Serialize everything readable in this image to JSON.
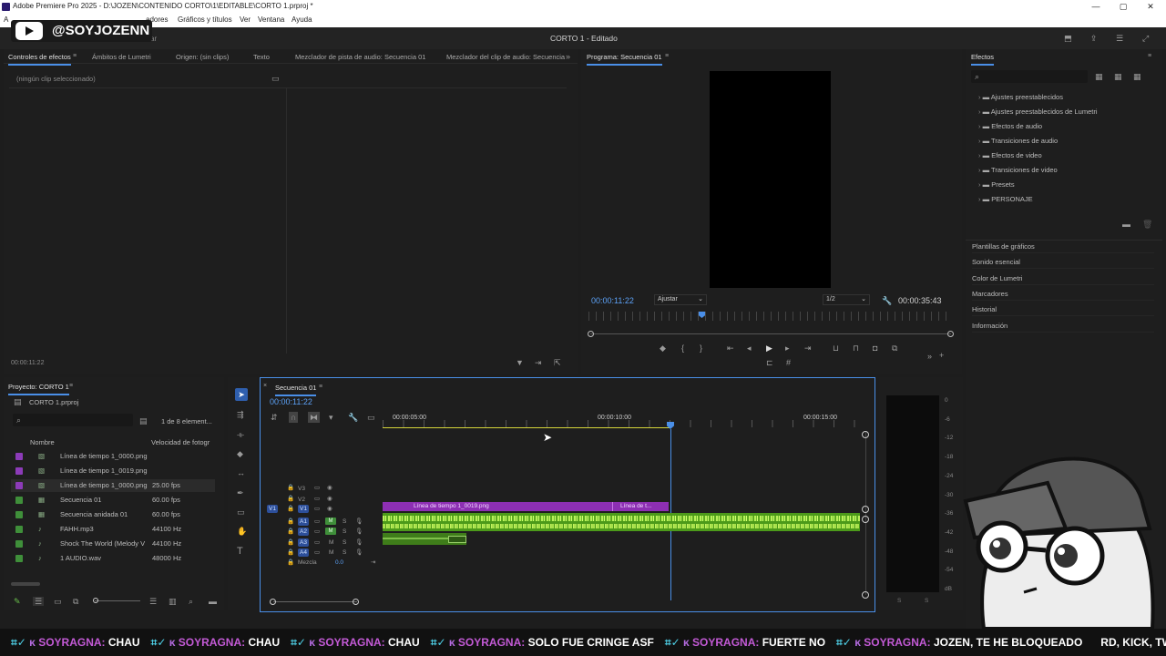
{
  "titlebar": {
    "title": "Adobe Premiere Pro 2025 - D:\\JOZEN\\CONTENIDO CORTO\\1\\EDITABLE\\CORTO 1.prproj *"
  },
  "menu": {
    "items": [
      "A",
      "adores",
      "Gráficos y títulos",
      "Ver",
      "Ventana",
      "Ayuda"
    ],
    "hidden_partial": "ar"
  },
  "workspace": {
    "title": "CORTO 1 - Editado"
  },
  "overlay": {
    "handle": "@SOYJOZENN"
  },
  "left_top_tabs": [
    "Controles de efectos",
    "Ámbitos de Lumetri",
    "Origen: (sin clips)",
    "Texto",
    "Mezclador de pista de audio: Secuencia 01",
    "Mezclador del clip de audio: Secuencia"
  ],
  "effect_controls": {
    "empty": "(ningún clip seleccionado)",
    "timecode": "00:00:11:22"
  },
  "program": {
    "tab": "Programa: Secuencia 01",
    "timecode": "00:00:11:22",
    "fit": "Ajustar",
    "res": "1/2",
    "duration": "00:00:35:43"
  },
  "effects": {
    "tab": "Efectos",
    "tree": [
      "Ajustes preestablecidos",
      "Ajustes preestablecidos de Lumetri",
      "Efectos de audio",
      "Transiciones de audio",
      "Efectos de video",
      "Transiciones de video",
      "Presets",
      "PERSONAJE"
    ],
    "panels": [
      "Plantillas de gráficos",
      "Sonido esencial",
      "Color de Lumetri",
      "Marcadores",
      "Historial",
      "Información"
    ]
  },
  "project": {
    "tab": "Proyecto: CORTO 1",
    "file": "CORTO 1.prproj",
    "count": "1 de 8 element...",
    "col_name": "Nombre",
    "col_fps": "Velocidad de fotogr",
    "items": [
      {
        "name": "Línea de tiempo 1_0000.png",
        "fps": "",
        "color": "#8c3bb8"
      },
      {
        "name": "Línea de tiempo 1_0019.png",
        "fps": "",
        "color": "#8c3bb8"
      },
      {
        "name": "Línea de tiempo 1_0000.png",
        "fps": "25.00 fps",
        "color": "#8c3bb8"
      },
      {
        "name": "Secuencia 01",
        "fps": "60.00 fps",
        "color": "#3f8f3a"
      },
      {
        "name": "Secuencia anidada 01",
        "fps": "60.00 fps",
        "color": "#3f8f3a"
      },
      {
        "name": "FAHH.mp3",
        "fps": "44100 Hz",
        "color": "#3f8f3a"
      },
      {
        "name": "Shock The World (Melody V",
        "fps": "44100 Hz",
        "color": "#3f8f3a"
      },
      {
        "name": "1 AUDIO.wav",
        "fps": "48000 Hz",
        "color": "#3f8f3a"
      }
    ]
  },
  "timeline": {
    "tab": "Secuencia 01",
    "timecode": "00:00:11:22",
    "ruler": [
      "00:00:05:00",
      "00:00:10:00",
      "00:00:15:00"
    ],
    "tracks": [
      "V3",
      "V2",
      "V1",
      "A1",
      "A2",
      "A3",
      "A4"
    ],
    "mix": "Mezcla",
    "mix_val": "0.0",
    "clip1": "Línea de tiempo 1_0019.png",
    "clip2": "Línea de t..."
  },
  "meter": {
    "scale": [
      "0",
      "-6",
      "-12",
      "-18",
      "-24",
      "-30",
      "-36",
      "-42",
      "-48",
      "-54",
      "dB"
    ],
    "bottom": [
      "S",
      "S"
    ]
  },
  "chat": [
    {
      "user": "SOYRAGNA:",
      "msg": "CHAU"
    },
    {
      "user": "SOYRAGNA:",
      "msg": "CHAU"
    },
    {
      "user": "SOYRAGNA:",
      "msg": "CHAU"
    },
    {
      "user": "SOYRAGNA:",
      "msg": "SOLO FUE CRINGE ASF"
    },
    {
      "user": "SOYRAGNA:",
      "msg": "FUERTE NO"
    },
    {
      "user": "SOYRAGNA:",
      "msg": "JOZEN, TE HE BLOQUEADO"
    }
  ],
  "chat_tail": "RD, KICK, TWITC"
}
